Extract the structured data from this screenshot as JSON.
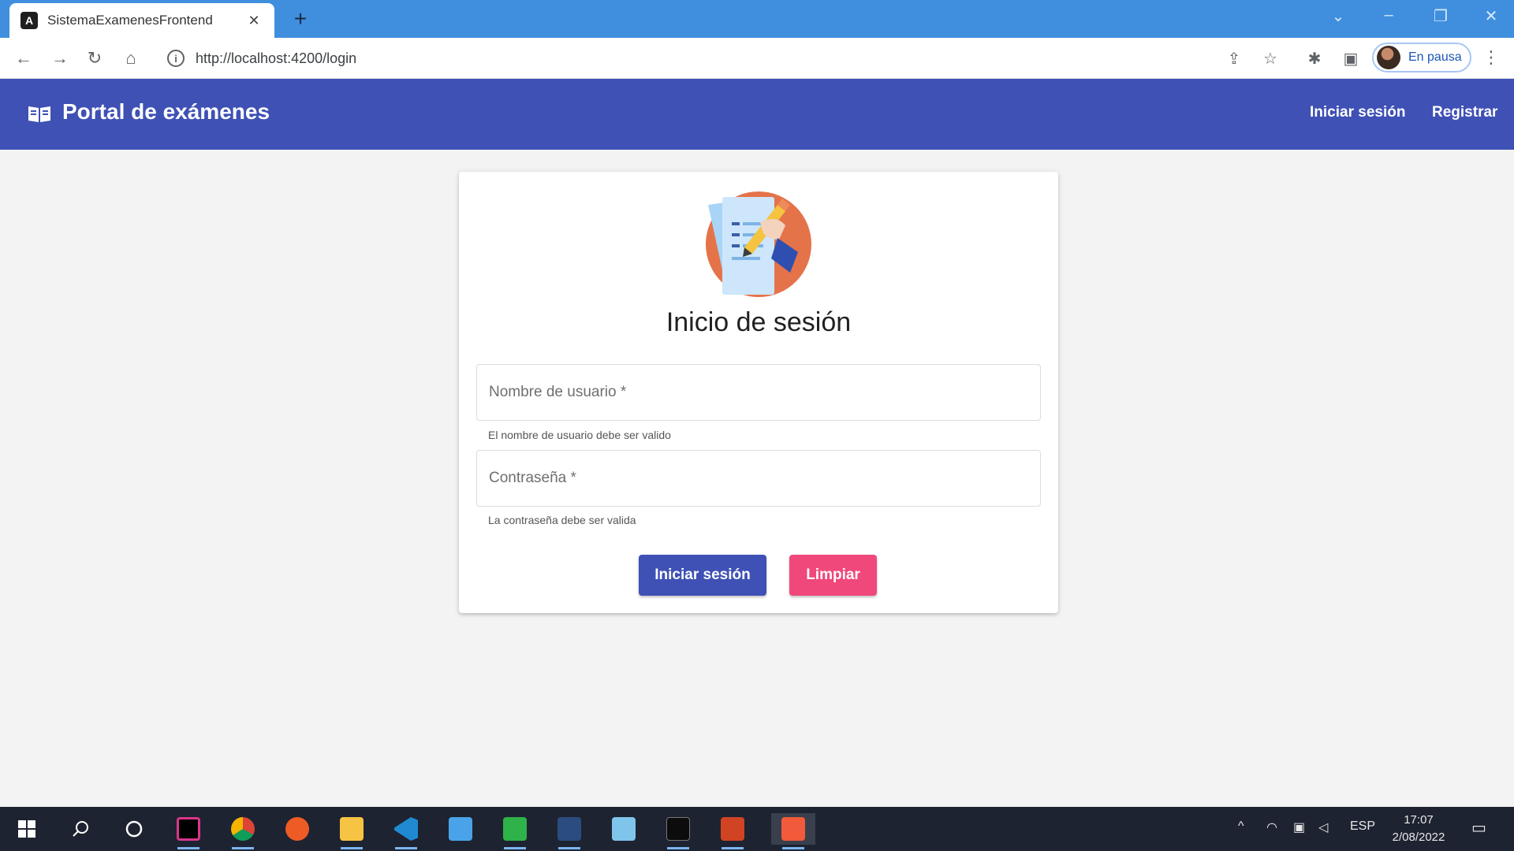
{
  "browser": {
    "tab_title": "SistemaExamenesFrontend",
    "tab_close": "✕",
    "new_tab": "+",
    "url": "http://localhost:4200/login",
    "profile_label": "En pausa"
  },
  "app": {
    "brand": "Portal de exámenes",
    "nav": {
      "login": "Iniciar sesión",
      "register": "Registrar"
    }
  },
  "login_card": {
    "title": "Inicio de sesión",
    "username_label": "Nombre de usuario *",
    "username_hint": "El nombre de usuario debe ser valido",
    "password_label": "Contraseña *",
    "password_hint": "La contraseña debe ser valida",
    "submit_label": "Iniciar sesión",
    "clear_label": "Limpiar"
  },
  "taskbar": {
    "apps": [
      "windows-start-icon",
      "search-icon",
      "cortana-icon",
      "intellij-icon",
      "chrome-icon",
      "postman-icon",
      "file-explorer-icon",
      "vscode-icon",
      "remote-desktop-icon",
      "camtasia-icon",
      "mysql-workbench-icon",
      "notepad-icon",
      "terminal-icon",
      "powerpoint-icon",
      "recorder-icon"
    ],
    "language": "ESP",
    "time": "17:07",
    "date": "2/08/2022"
  },
  "colors": {
    "primary": "#3f51b5",
    "accent": "#f0487a",
    "browser_frame": "#3f8fde",
    "background": "#f3f3f4"
  }
}
